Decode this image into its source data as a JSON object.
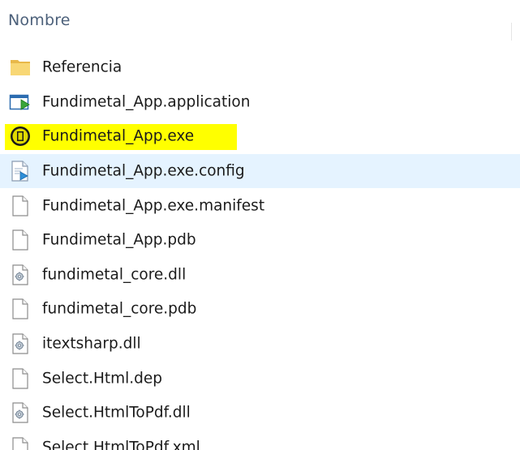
{
  "header": {
    "column_name": "Nombre"
  },
  "files": [
    {
      "name": "Referencia",
      "icon": "folder-icon",
      "type": "folder"
    },
    {
      "name": "Fundimetal_App.application",
      "icon": "application-manifest-icon",
      "type": "application"
    },
    {
      "name": "Fundimetal_App.exe",
      "icon": "exe-icon",
      "type": "exe",
      "highlighted": true
    },
    {
      "name": "Fundimetal_App.exe.config",
      "icon": "config-file-icon",
      "type": "config",
      "hovered": true
    },
    {
      "name": "Fundimetal_App.exe.manifest",
      "icon": "file-icon",
      "type": "generic"
    },
    {
      "name": "Fundimetal_App.pdb",
      "icon": "file-icon",
      "type": "generic"
    },
    {
      "name": "fundimetal_core.dll",
      "icon": "dll-icon",
      "type": "dll"
    },
    {
      "name": "fundimetal_core.pdb",
      "icon": "file-icon",
      "type": "generic"
    },
    {
      "name": "itextsharp.dll",
      "icon": "dll-icon",
      "type": "dll"
    },
    {
      "name": "Select.Html.dep",
      "icon": "file-icon",
      "type": "generic"
    },
    {
      "name": "Select.HtmlToPdf.dll",
      "icon": "dll-icon",
      "type": "dll"
    },
    {
      "name": "Select.HtmlToPdf.xml",
      "icon": "file-icon",
      "type": "generic"
    }
  ],
  "colors": {
    "highlight": "#ffff00",
    "hover": "#e5f3ff",
    "header_text": "#4c607a",
    "folder": "#f8d775"
  }
}
